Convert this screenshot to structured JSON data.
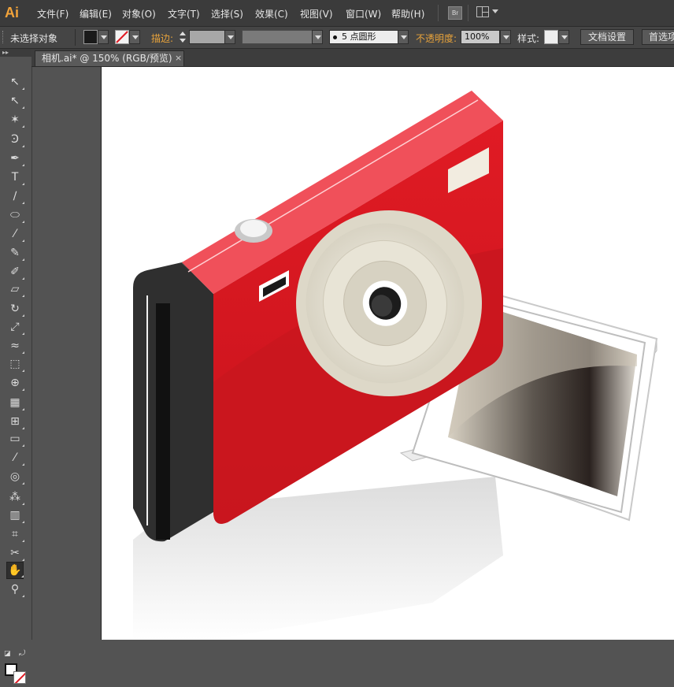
{
  "app": {
    "logo": "Ai"
  },
  "menubar": {
    "items": [
      "文件(F)",
      "编辑(E)",
      "对象(O)",
      "文字(T)",
      "选择(S)",
      "效果(C)",
      "视图(V)",
      "窗口(W)",
      "帮助(H)"
    ],
    "bridge_label": "Br"
  },
  "control_bar": {
    "selection_label": "未选择对象",
    "stroke_label": "描边:",
    "brush_value": "5 点圆形",
    "opacity_label": "不透明度:",
    "opacity_value": "100%",
    "style_label": "样式:",
    "doc_setup_button": "文档设置",
    "prefs_button": "首选项"
  },
  "document_tab": {
    "title": "相机.ai* @ 150% (RGB/预览)",
    "close": "×"
  },
  "toolbar": {
    "header": "▸▸",
    "tools": [
      {
        "name": "selection-tool-icon",
        "glyph": "↖"
      },
      {
        "name": "direct-selection-tool-icon",
        "glyph": "↖"
      },
      {
        "name": "magic-wand-tool-icon",
        "glyph": "✶"
      },
      {
        "name": "lasso-tool-icon",
        "glyph": "Ͽ"
      },
      {
        "name": "pen-tool-icon",
        "glyph": "✒"
      },
      {
        "name": "type-tool-icon",
        "glyph": "T"
      },
      {
        "name": "line-tool-icon",
        "glyph": "∕"
      },
      {
        "name": "ellipse-tool-icon",
        "glyph": "⬭"
      },
      {
        "name": "paintbrush-tool-icon",
        "glyph": "⁄"
      },
      {
        "name": "pencil-tool-icon",
        "glyph": "✎"
      },
      {
        "name": "blob-brush-tool-icon",
        "glyph": "✐"
      },
      {
        "name": "eraser-tool-icon",
        "glyph": "▱"
      },
      {
        "name": "rotate-tool-icon",
        "glyph": "↻"
      },
      {
        "name": "scale-tool-icon",
        "glyph": "⤢"
      },
      {
        "name": "width-tool-icon",
        "glyph": "≈"
      },
      {
        "name": "free-transform-tool-icon",
        "glyph": "⬚"
      },
      {
        "name": "shape-builder-tool-icon",
        "glyph": "⊕"
      },
      {
        "name": "perspective-grid-tool-icon",
        "glyph": "▦"
      },
      {
        "name": "mesh-tool-icon",
        "glyph": "⊞"
      },
      {
        "name": "gradient-tool-icon",
        "glyph": "▭"
      },
      {
        "name": "eyedropper-tool-icon",
        "glyph": "⁄"
      },
      {
        "name": "blend-tool-icon",
        "glyph": "◎"
      },
      {
        "name": "symbol-sprayer-tool-icon",
        "glyph": "⁂"
      },
      {
        "name": "column-graph-tool-icon",
        "glyph": "▥"
      },
      {
        "name": "artboard-tool-icon",
        "glyph": "⌗"
      },
      {
        "name": "slice-tool-icon",
        "glyph": "✂"
      },
      {
        "name": "hand-tool-icon",
        "glyph": "✋"
      },
      {
        "name": "zoom-tool-icon",
        "glyph": "⚲"
      }
    ]
  },
  "colors": {
    "camera_red": "#e01b24",
    "camera_top": "#f0505a",
    "camera_side_dark": "#2b2b2b",
    "lens_cream": "#e9e6d8",
    "accent_orange": "#f2a33a"
  }
}
